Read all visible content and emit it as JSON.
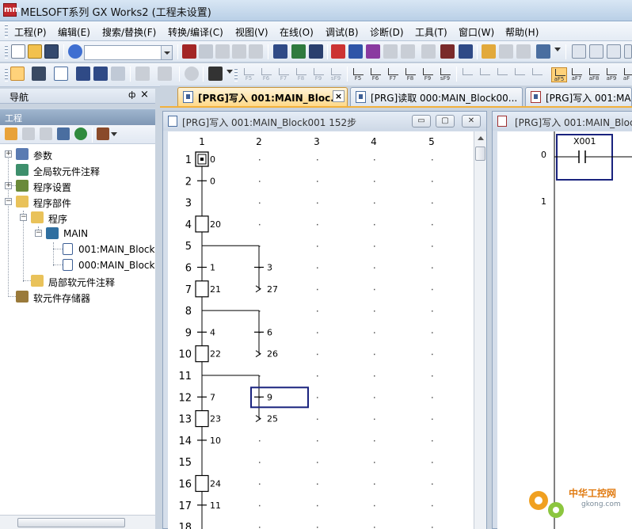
{
  "window": {
    "title": "MELSOFT系列 GX Works2 (工程未设置)",
    "icon_text": "mm"
  },
  "menu": {
    "items": [
      "工程(P)",
      "编辑(E)",
      "搜索/替换(F)",
      "转换/编译(C)",
      "视图(V)",
      "在线(O)",
      "调试(B)",
      "诊断(D)",
      "工具(T)",
      "窗口(W)",
      "帮助(H)"
    ]
  },
  "toolbar2": {
    "fkeys": [
      "F5",
      "F6",
      "F7",
      "F8",
      "F9",
      "sF9",
      "F5",
      "F6",
      "F7",
      "F8",
      "F9",
      "sF9",
      "aF5",
      "aF7",
      "aF8",
      "aF9",
      "aF"
    ]
  },
  "navigation": {
    "title": "导航",
    "pin": "ф",
    "close": "×",
    "project_title": "工程",
    "tree": [
      {
        "label": "参数"
      },
      {
        "label": "全局软元件注释"
      },
      {
        "label": "程序设置"
      },
      {
        "label": "程序部件"
      },
      {
        "label": "程序"
      },
      {
        "label": "MAIN"
      },
      {
        "label": "001:MAIN_Block"
      },
      {
        "label": "000:MAIN_Block"
      },
      {
        "label": "局部软元件注释"
      },
      {
        "label": "软元件存储器"
      }
    ],
    "expanders": {
      "collapsed": "+",
      "expanded": "−"
    }
  },
  "tabs": [
    {
      "label": "[PRG]写入 001:MAIN_Bloc...",
      "active": true,
      "close": "×"
    },
    {
      "label": "[PRG]读取 000:MAIN_Block00..."
    },
    {
      "label": "[PRG]写入 001:MAIN_Bl"
    }
  ],
  "sfc_window": {
    "title": "[PRG]写入 001:MAIN_Block001 152步",
    "buttons": {
      "minimize": "▭",
      "restore": "▢",
      "close": "✕"
    },
    "columns": [
      "1",
      "2",
      "3",
      "4",
      "5"
    ],
    "rows": [
      {
        "n": "1",
        "kind": "initial",
        "label": "0"
      },
      {
        "n": "2",
        "kind": "transition",
        "label": "0"
      },
      {
        "n": "3",
        "kind": "blank"
      },
      {
        "n": "4",
        "kind": "step",
        "label": "20"
      },
      {
        "n": "5",
        "kind": "branch"
      },
      {
        "n": "6",
        "kind": "transition",
        "label": "1",
        "branch_label": "3"
      },
      {
        "n": "7",
        "kind": "step",
        "label": "21",
        "jump_label": "27"
      },
      {
        "n": "8",
        "kind": "branch"
      },
      {
        "n": "9",
        "kind": "transition",
        "label": "4",
        "branch_label": "6"
      },
      {
        "n": "10",
        "kind": "step",
        "label": "22",
        "jump_label": "26"
      },
      {
        "n": "11",
        "kind": "branch"
      },
      {
        "n": "12",
        "kind": "transition",
        "label": "7",
        "branch_label": "9",
        "cursor": true
      },
      {
        "n": "13",
        "kind": "step",
        "label": "23",
        "jump_label": "25"
      },
      {
        "n": "14",
        "kind": "transition",
        "label": "10"
      },
      {
        "n": "15",
        "kind": "blank"
      },
      {
        "n": "16",
        "kind": "step",
        "label": "24"
      },
      {
        "n": "17",
        "kind": "transition",
        "label": "11"
      },
      {
        "n": "18",
        "kind": "blank"
      }
    ]
  },
  "ladder_window": {
    "title": "[PRG]写入 001:MAIN_Block",
    "contact_label": "X001",
    "line_numbers": [
      "0",
      "1"
    ]
  },
  "watermark": {
    "text1": "中华工控网",
    "text2": "gkong.com"
  },
  "colors": {
    "accent": "#f2b13c",
    "cursor": "#1a237e",
    "active_tab": "#ffd98a"
  }
}
